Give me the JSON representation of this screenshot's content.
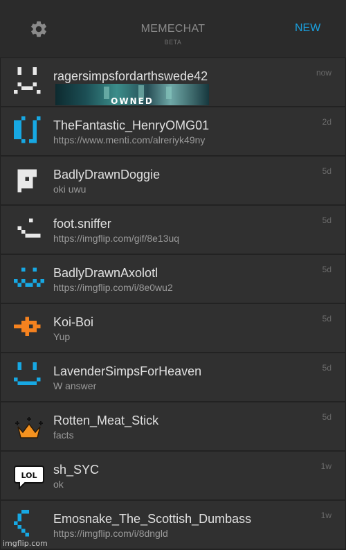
{
  "header": {
    "title": "MEMECHAT",
    "subtitle": "BETA",
    "new_label": "NEW",
    "settings_icon": "gear-icon"
  },
  "conversations": [
    {
      "username": "ragersimpsfordarthswede42",
      "preview": "",
      "time": "now",
      "attachment_text": "OWNED",
      "avatar": "ghost-face",
      "color": "#e8e8e8"
    },
    {
      "username": "TheFantastic_HenryOMG01",
      "preview": "https://www.menti.com/alreriyk49ny",
      "time": "2d",
      "avatar": "brackets-face",
      "color": "#17a8e3"
    },
    {
      "username": "BadlyDrawnDoggie",
      "preview": "oki uwu",
      "time": "5d",
      "avatar": "dog-face",
      "color": "#e8e8e8"
    },
    {
      "username": "foot.sniffer",
      "preview": "https://imgflip.com/gif/8e13uq",
      "time": "5d",
      "avatar": "smirk-face",
      "color": "#e8e8e8"
    },
    {
      "username": "BadlyDrawnAxolotl",
      "preview": "https://imgflip.com/i/8e0wu2",
      "time": "5d",
      "avatar": "axolotl-face",
      "color": "#17a8e3"
    },
    {
      "username": "Koi-Boi",
      "preview": "Yup",
      "time": "5d",
      "avatar": "fish-icon",
      "color": "#f5821f"
    },
    {
      "username": "LavenderSimpsForHeaven",
      "preview": "W answer",
      "time": "5d",
      "avatar": "smile-face",
      "color": "#17a8e3"
    },
    {
      "username": "Rotten_Meat_Stick",
      "preview": "facts",
      "time": "5d",
      "avatar": "crown-icon",
      "color": "#f5921f"
    },
    {
      "username": "sh_SYC",
      "preview": "ok",
      "time": "1w",
      "avatar": "lol-bubble-icon",
      "color": "#ffffff"
    },
    {
      "username": "Emosnake_The_Scottish_Dumbass",
      "preview": "https://imgflip.com/i/8dngld",
      "time": "1w",
      "avatar": "snake-icon",
      "color": "#17a8e3"
    }
  ],
  "watermark": "imgflip.com"
}
